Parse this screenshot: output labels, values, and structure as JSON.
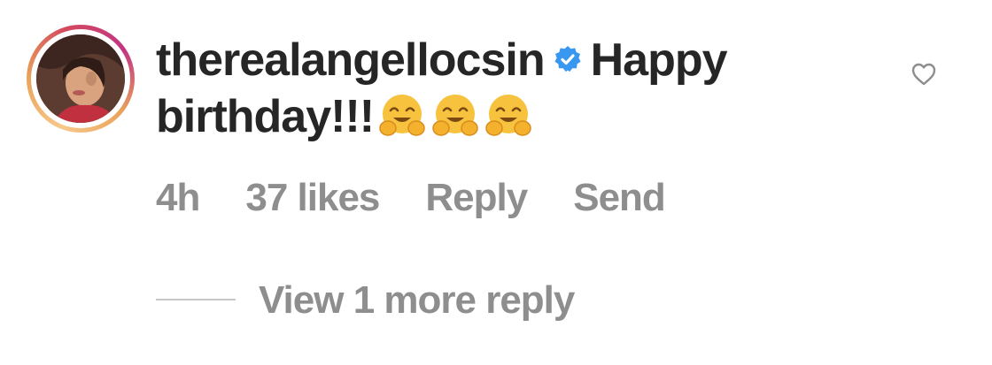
{
  "comment": {
    "username": "therealangellocsin",
    "verified_icon": "verified-badge-icon",
    "text": "Happy birthday!!!",
    "emojis": [
      "hugging-face-emoji",
      "hugging-face-emoji",
      "hugging-face-emoji"
    ],
    "like_icon": "heart-outline-icon"
  },
  "meta": {
    "time": "4h",
    "likes": "37 likes",
    "reply_label": "Reply",
    "send_label": "Send"
  },
  "replies": {
    "view_more_label": "View 1 more reply"
  },
  "colors": {
    "text_primary": "#262626",
    "text_secondary": "#8e8e8e",
    "verified_blue": "#3897f0",
    "divider": "#c7c7c7"
  }
}
